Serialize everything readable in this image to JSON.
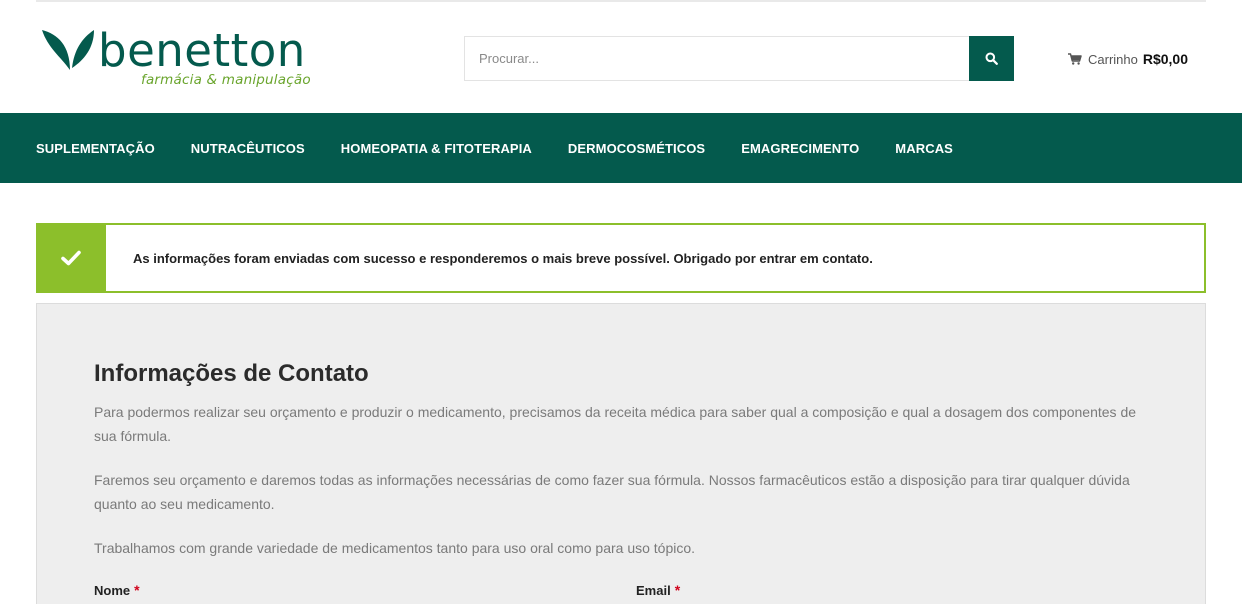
{
  "brand": {
    "name": "benetton",
    "tagline": "farmácia & manipulação",
    "colors": {
      "primary": "#045a4d",
      "accent": "#6aa52d",
      "success": "#8cbf2b"
    }
  },
  "search": {
    "placeholder": "Procurar...",
    "icon": "search-icon"
  },
  "cart": {
    "label": "Carrinho",
    "total": "R$0,00",
    "icon": "cart-icon"
  },
  "nav": {
    "items": [
      "SUPLEMENTAÇÃO",
      "NUTRACÊUTICOS",
      "HOMEOPATIA & FITOTERAPIA",
      "DERMOCOSMÉTICOS",
      "EMAGRECIMENTO",
      "MARCAS"
    ]
  },
  "notice": {
    "icon": "check-icon",
    "message": "As informações foram enviadas com sucesso e responderemos o mais breve possível. Obrigado por entrar em contato."
  },
  "contact": {
    "title": "Informações de Contato",
    "paragraphs": [
      "Para podermos realizar seu orçamento e produzir o medicamento, precisamos da receita médica para saber qual a composição e qual a dosagem dos componentes de sua fórmula.",
      "Faremos seu orçamento e daremos todas as informações necessárias de como fazer sua fórmula. Nossos farmacêuticos estão a disposição para tirar qualquer dúvida quanto ao seu medicamento.",
      "Trabalhamos com grande variedade de medicamentos tanto para uso oral como para uso tópico."
    ],
    "fields": {
      "name_label": "Nome",
      "email_label": "Email",
      "required_mark": "*"
    }
  }
}
